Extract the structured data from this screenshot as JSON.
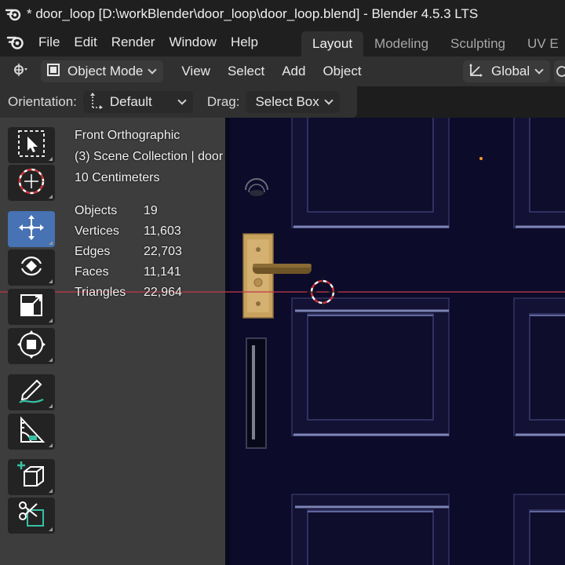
{
  "window": {
    "title": "* door_loop [D:\\workBlender\\door_loop\\door_loop.blend] - Blender 4.5.3 LTS"
  },
  "menu": {
    "items": [
      "File",
      "Edit",
      "Render",
      "Window",
      "Help"
    ]
  },
  "workspaces": {
    "tabs": [
      "Layout",
      "Modeling",
      "Sculpting",
      "UV E"
    ],
    "active": "Layout"
  },
  "header": {
    "mode": "Object Mode",
    "items": [
      "View",
      "Select",
      "Add",
      "Object"
    ],
    "transform_orientation": "Global"
  },
  "tool_settings": {
    "orientation_label": "Orientation:",
    "orientation_value": "Default",
    "drag_label": "Drag:",
    "drag_value": "Select Box"
  },
  "toolbar": {
    "tools": [
      "select-box-tool",
      "cursor-tool",
      "move-tool",
      "rotate-tool",
      "scale-tool",
      "transform-tool",
      "annotate-tool",
      "measure-tool",
      "add-cube-tool",
      "knife-tool"
    ],
    "active": "move-tool"
  },
  "viewport": {
    "view_name": "Front Orthographic",
    "collection": "(3) Scene Collection | door",
    "grid_scale": "10 Centimeters",
    "stats": [
      {
        "label": "Objects",
        "value": "19"
      },
      {
        "label": "Vertices",
        "value": "11,603"
      },
      {
        "label": "Edges",
        "value": "22,703"
      },
      {
        "label": "Faces",
        "value": "11,141"
      },
      {
        "label": "Triangles",
        "value": "22,964"
      }
    ]
  },
  "colors": {
    "accent": "#4772b3",
    "viewport_bg": "#0b0a26",
    "x_axis": "#c23b4a",
    "handle": "#c9a25e"
  }
}
